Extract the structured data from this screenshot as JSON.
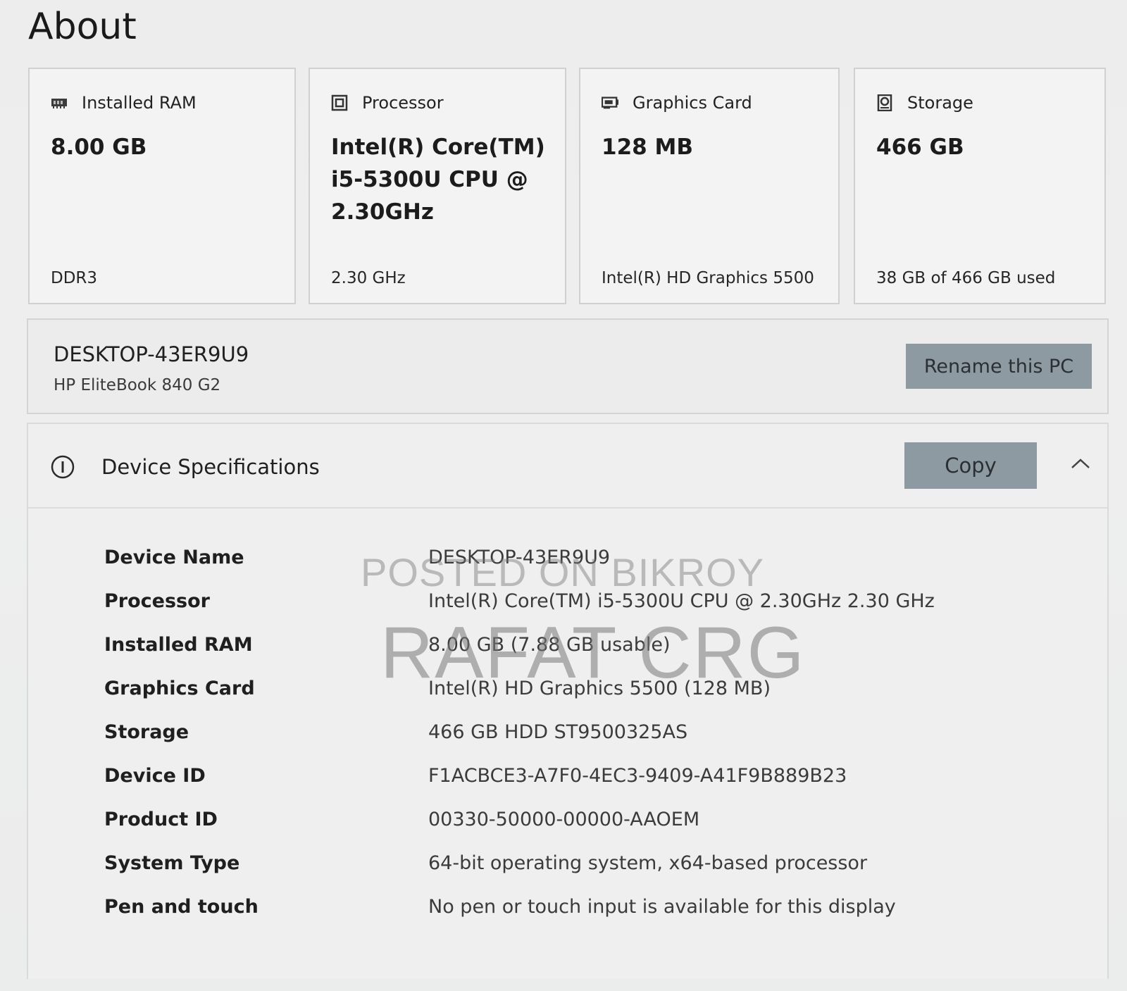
{
  "page": {
    "title": "About"
  },
  "cards": [
    {
      "label": "Installed RAM",
      "value": "8.00 GB",
      "sub": "DDR3",
      "icon": "ram-icon"
    },
    {
      "label": "Processor",
      "value": "Intel(R) Core(TM) i5-5300U CPU @ 2.30GHz",
      "sub": "2.30 GHz",
      "icon": "processor-icon"
    },
    {
      "label": "Graphics Card",
      "value": "128 MB",
      "sub": "Intel(R) HD Graphics 5500",
      "icon": "graphics-card-icon"
    },
    {
      "label": "Storage",
      "value": "466 GB",
      "sub": "38 GB of 466 GB used",
      "icon": "storage-icon"
    }
  ],
  "device": {
    "name": "DESKTOP-43ER9U9",
    "model": "HP EliteBook 840 G2",
    "rename_label": "Rename this PC"
  },
  "specs": {
    "title": "Device Specifications",
    "copy_label": "Copy",
    "rows": [
      {
        "label": "Device Name",
        "value": "DESKTOP-43ER9U9"
      },
      {
        "label": "Processor",
        "value": "Intel(R) Core(TM) i5-5300U CPU @ 2.30GHz   2.30 GHz"
      },
      {
        "label": "Installed RAM",
        "value": "8.00 GB (7.88 GB usable)"
      },
      {
        "label": "Graphics Card",
        "value": "Intel(R) HD Graphics 5500 (128 MB)"
      },
      {
        "label": "Storage",
        "value": "466 GB HDD ST9500325AS"
      },
      {
        "label": "Device ID",
        "value": "F1ACBCE3-A7F0-4EC3-9409-A41F9B889B23"
      },
      {
        "label": "Product ID",
        "value": "00330-50000-00000-AAOEM"
      },
      {
        "label": "System Type",
        "value": "64-bit operating system, x64-based processor"
      },
      {
        "label": "Pen and touch",
        "value": "No pen or touch input is available for this display"
      }
    ]
  },
  "watermark": {
    "line1": "POSTED ON BIKROY",
    "line2": "RAFAT CRG"
  },
  "colors": {
    "button": "#8e9aa2",
    "card_border": "#cfd1d1",
    "background": "#ececec"
  }
}
